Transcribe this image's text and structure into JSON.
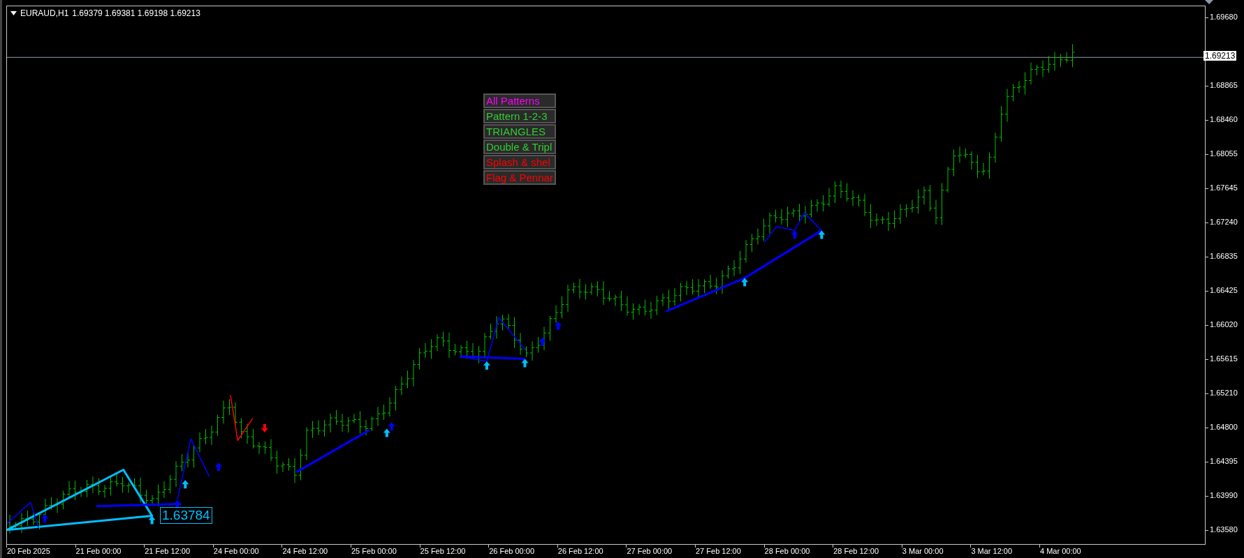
{
  "header": {
    "symbol": "EURAUD,H1",
    "quotes": "1.69379 1.69381 1.69198 1.69213"
  },
  "pattern_buttons": [
    {
      "label": "All Patterns",
      "kind": "master"
    },
    {
      "label": "Pattern 1-2-3",
      "kind": "pattern",
      "on": true
    },
    {
      "label": "TRIANGLES",
      "kind": "pattern",
      "on": true
    },
    {
      "label": "Double & Tripl",
      "kind": "pattern",
      "on": true
    },
    {
      "label": "Splash & shel",
      "kind": "pattern",
      "on": false
    },
    {
      "label": "Flag & Pennar",
      "kind": "pattern",
      "on": false
    }
  ],
  "price_label": "1.63784",
  "current_price": "1.69213",
  "price_axis": [
    "1.69680",
    "1.68865",
    "1.68460",
    "1.68055",
    "1.67645",
    "1.67240",
    "1.66835",
    "1.66425",
    "1.66020",
    "1.65615",
    "1.65210",
    "1.64800",
    "1.64395",
    "1.63990",
    "1.63580"
  ],
  "time_axis": [
    "20 Feb 2025",
    "21 Feb 00:00",
    "21 Feb 12:00",
    "24 Feb 00:00",
    "24 Feb 12:00",
    "25 Feb 00:00",
    "25 Feb 12:00",
    "26 Feb 00:00",
    "26 Feb 12:00",
    "27 Feb 00:00",
    "27 Feb 12:00",
    "28 Feb 00:00",
    "28 Feb 12:00",
    "3 Mar 00:00",
    "3 Mar 12:00",
    "4 Mar 00:00"
  ]
}
